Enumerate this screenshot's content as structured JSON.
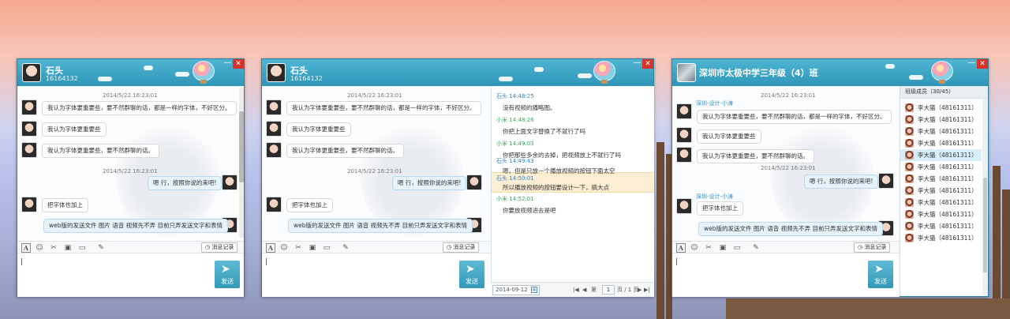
{
  "windows": [
    {
      "title_name": "石头",
      "title_id": "16164132",
      "messages": {
        "ts1": "2014/5/22 16:23:01",
        "m1": "我认为字体要重要些，要不然群聊的话，都是一样的字体，不好区分。",
        "m2": "我认为字体更重要些",
        "m3": "我认为字体更重要些，要不然群聊的话。",
        "ts2": "2014/5/22 16:23:01",
        "m4": "嗯  行，按照你说的来吧!",
        "m5": "把字体也加上",
        "m6": "web版的发送文件  图片  语音  视频先不弄  目前只弄发送文字和表情"
      },
      "history_label": "消息记录",
      "send_label": "发送"
    },
    {
      "title_name": "石头",
      "title_id": "16164132",
      "messages": {
        "ts1": "2014/5/22 16:23:01",
        "m1": "我认为字体要重要些，要不然群聊的话，都是一样的字体，不好区分。",
        "m2": "我认为字体更重要些",
        "m3": "我认为字体更重要些，要不然群聊的话。",
        "ts2": "2014/5/22 16:23:01",
        "m4": "嗯  行，按照你说的来吧!",
        "m5": "把字体也加上",
        "m6": "web版的发送文件  图片  语音  视频先不弄  目前只弄发送文字和表情"
      },
      "history_label": "消息记录",
      "send_label": "发送",
      "history": [
        {
          "who": "石头",
          "time": "14:48:25",
          "msg": "没有视频的播略图。",
          "style": "a"
        },
        {
          "who": "小米",
          "time": "14:48:26",
          "msg": "你把上面文字替换了不就行了吗",
          "style": "b"
        },
        {
          "who": "小米",
          "time": "14:49:03",
          "msg": "你把那些多余的去掉，把视频放上不就行了吗",
          "style": "b"
        },
        {
          "who": "石头",
          "time": "14:49:43",
          "msg": "嗯，但是只放一个播放视频的按钮下面太空",
          "style": "a"
        },
        {
          "who": "石头",
          "time": "14:50:01",
          "msg": "所以播放视频的按钮要设计一下，搞大点",
          "style": "a"
        },
        {
          "who": "小米",
          "time": "14:52:01",
          "msg": "你要放视频进去是吧",
          "style": "b"
        }
      ],
      "pager": {
        "date": "2014-09-12",
        "first": "第",
        "page": "1",
        "of_total": "页 / 1 页"
      }
    },
    {
      "title_group": "深圳市太极中学三年级（4）班",
      "messages": {
        "ts1": "2014/5/22 16:23:01",
        "sender1": "深圳-设计-小涛",
        "m1": "我认为字体要重要些，要不然群聊的话，都是一样的字体，不好区分。",
        "m2": "我认为字体更重要些",
        "m3": "我认为字体更重要些，要不然群聊的话。",
        "ts2": "2014/5/22 16:23:01",
        "m4": "嗯  行，按照你说的来吧!",
        "sender2": "深圳-设计-小涛",
        "m5": "把字体也加上",
        "m6": "web版的发送文件  图片  语音  视频先不弄  目前只弄发送文字和表情"
      },
      "history_label": "消息记录",
      "send_label": "发送",
      "members_header": "班级成员（30/45）",
      "members": [
        "李大猫（48161311）",
        "李大猫（48161311）",
        "李大猫（48161311）",
        "李大猫（48161311）",
        "李大猫（48161311）",
        "李大猫（48161311）",
        "李大猫（48161311）",
        "李大猫（48161311）",
        "李大猫（48161311）",
        "李大猫（48161311）",
        "李大猫（48161311）",
        "李大猫（48161311）"
      ]
    }
  ],
  "icons": {
    "font": "A",
    "emoji": "☺",
    "scissors": "✂",
    "image": "▣",
    "folder": "▭",
    "brush": "✎",
    "clock": "◷",
    "close": "✕",
    "minimize": "—",
    "send_plane": "➤",
    "cal": "▦",
    "first": "|◀",
    "prev": "◀",
    "next": "▶",
    "last": "▶|"
  },
  "colors": {
    "title_bar": "#3aa3c4",
    "send_button": "#3ea3c1",
    "close_button": "#d9322b",
    "history_highlight": "#fbeed2"
  }
}
